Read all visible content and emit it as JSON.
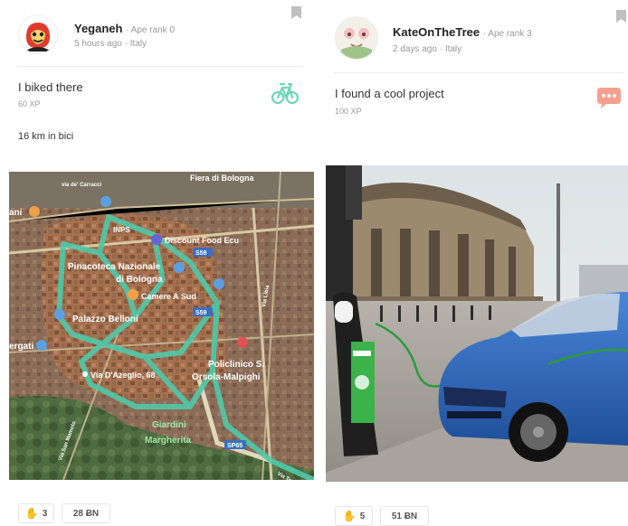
{
  "cards": [
    {
      "user": {
        "name": "Yeganeh",
        "rank": "· Ape rank 0"
      },
      "meta": "5 hours ago · Italy",
      "activity": {
        "title": "I biked there",
        "xp": "60 XP",
        "icon": "bicycle-icon",
        "color": "#6fd6b5"
      },
      "description": "16 km in bici",
      "map_labels": {
        "fiera": "Fiera di Bologna",
        "via_carracci": "via de' Carracci",
        "ani": "ani",
        "inps": "INPS",
        "discount": "Discount Food Ecu",
        "pinacoteca1": "Pinacoteca Nazionale",
        "pinacoteca2": "di Bologna",
        "camere": "Camere A Sud",
        "palazzo": "Palazzo Belloni",
        "s59a": "S59",
        "s59b": "S59",
        "via_libia": "Via Libia",
        "ergati": "ergati",
        "policlinico1": "Policlinico S.",
        "policlinico2": "Orsola-Malpighi",
        "azeglio": "Via D'Azeglio, 68",
        "giardini1": "Giardini",
        "giardini2": "Margherita",
        "sp65": "SP65",
        "via_san_mamolo": "Via San Mamolo",
        "via_toscana": "Via Toscana"
      },
      "actions": {
        "likes": "3",
        "coins": "28 ɃN"
      }
    },
    {
      "user": {
        "name": "KateOnTheTree",
        "rank": "· Ape rank 3"
      },
      "meta": "2 days ago · Italy",
      "activity": {
        "title": "I found a cool project",
        "xp": "100 XP",
        "icon": "chat-bubble-icon",
        "color": "#f5a08f"
      },
      "actions": {
        "likes": "5",
        "coins": "51 ɃN"
      }
    }
  ]
}
